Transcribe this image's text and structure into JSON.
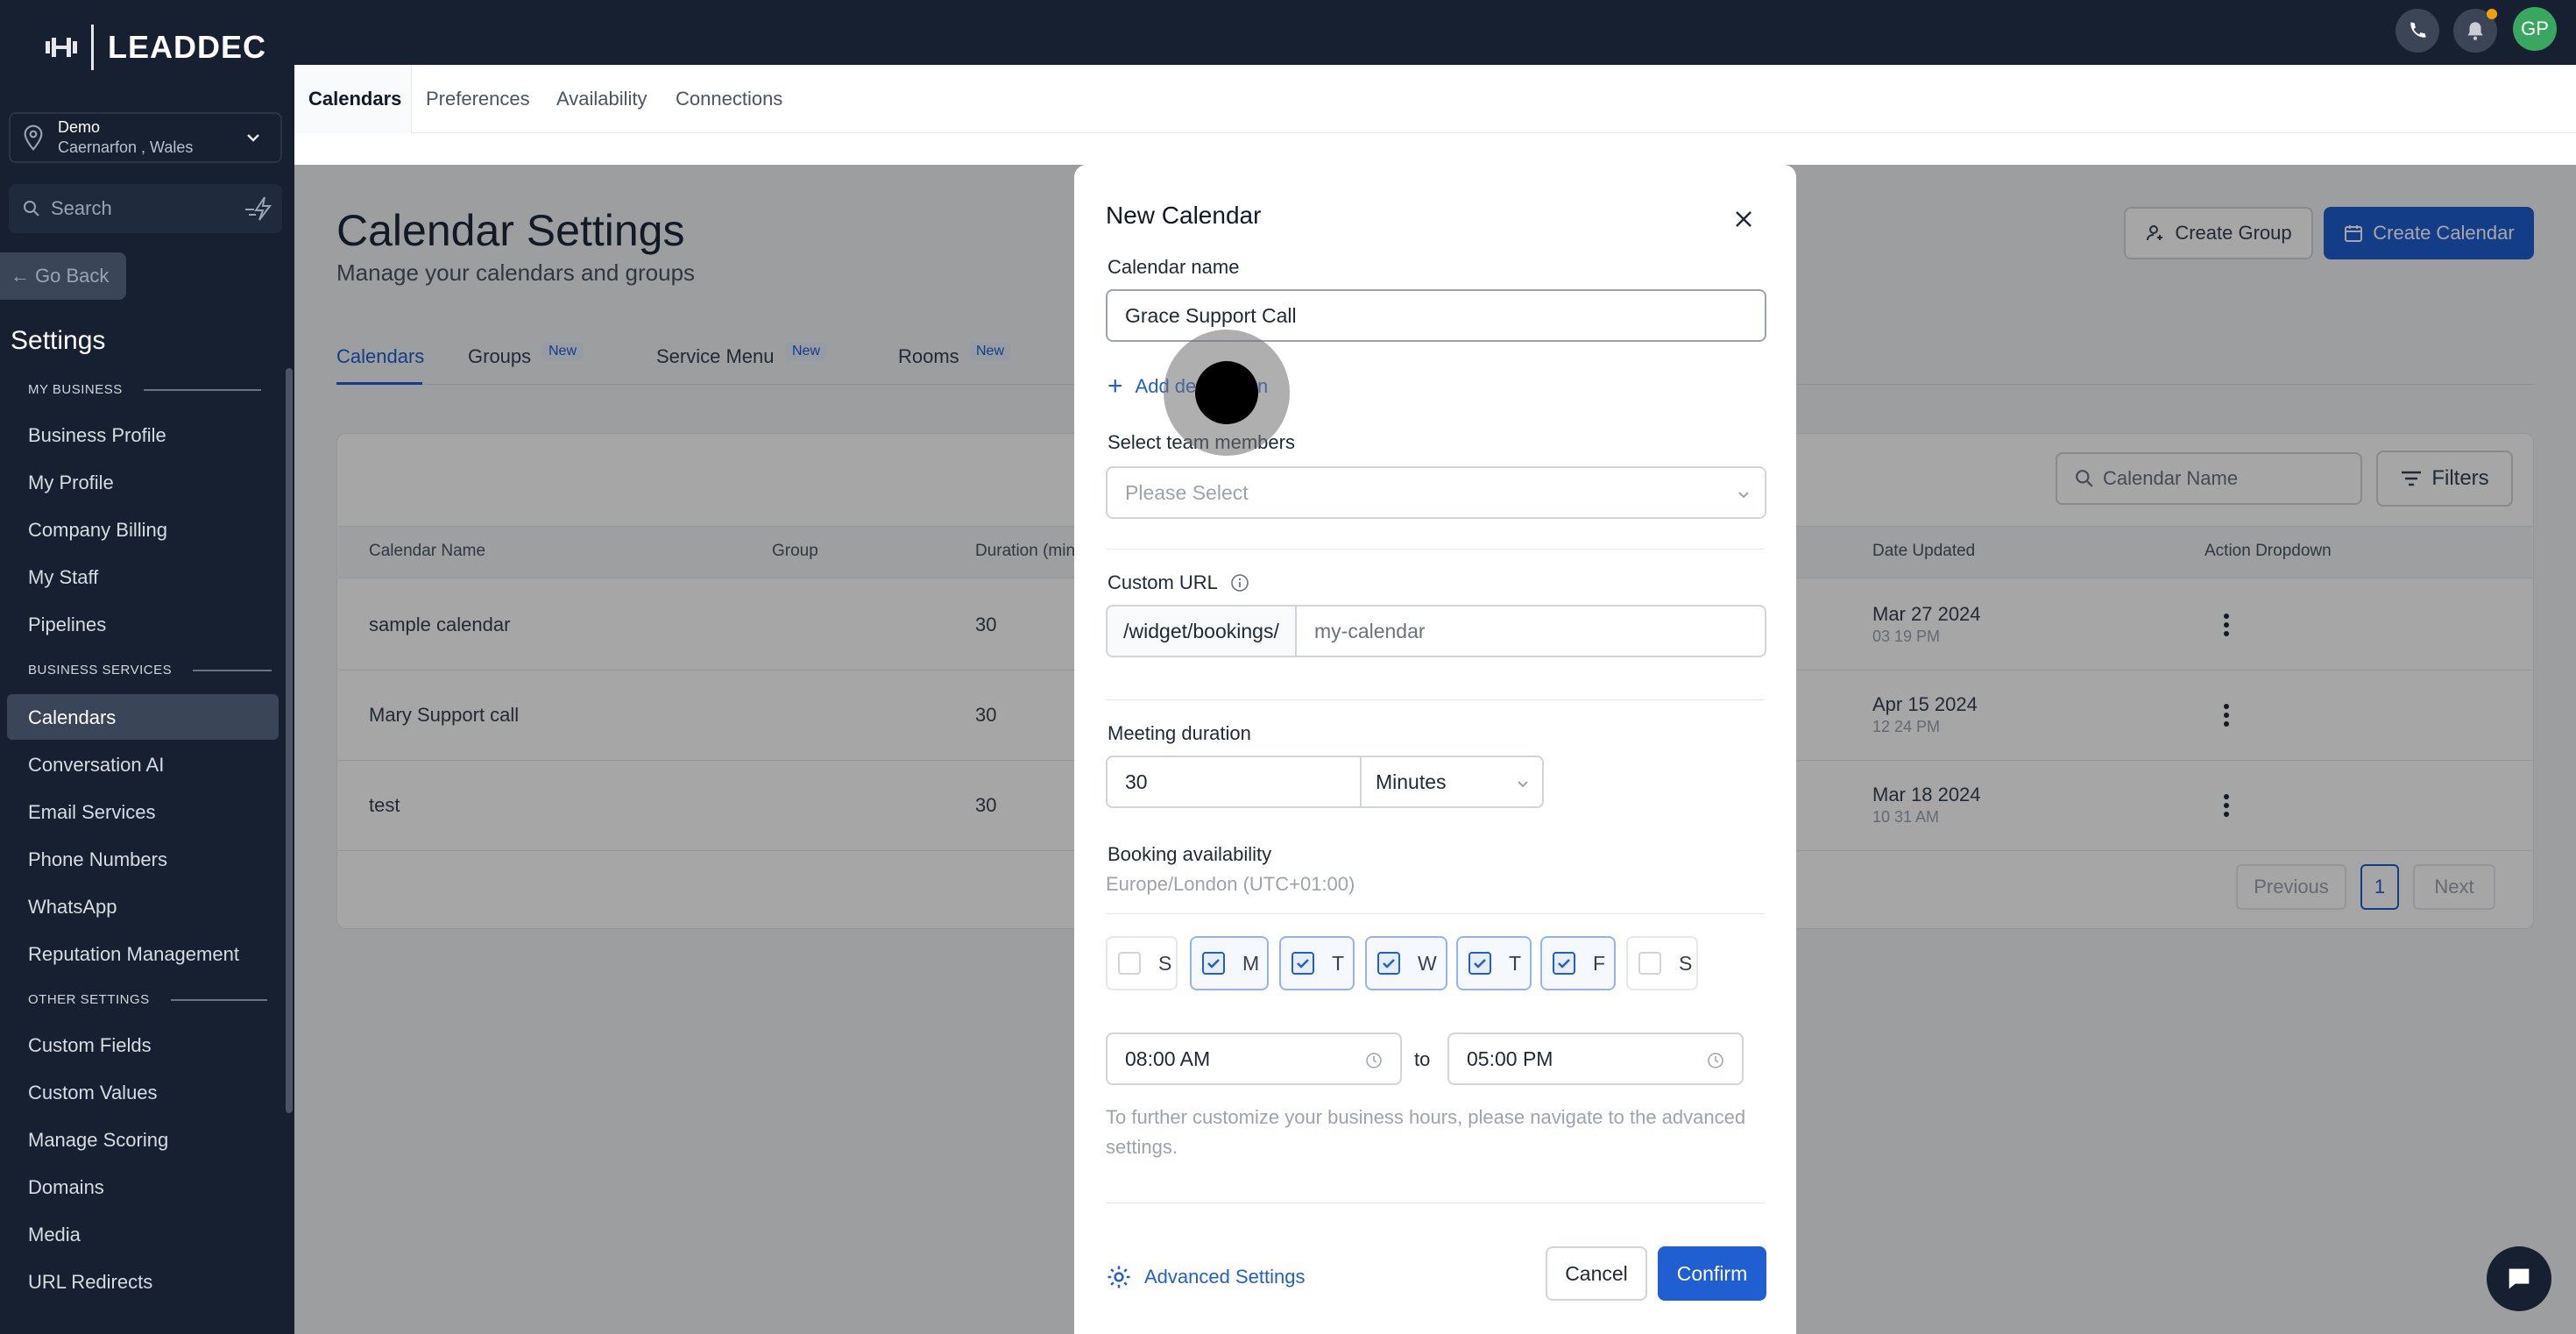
{
  "brand": {
    "name": "LEADDEC"
  },
  "location": {
    "name": "Demo",
    "address": "Caernarfon , Wales"
  },
  "sidebar": {
    "search_placeholder": "Search",
    "go_back": "Go Back",
    "title": "Settings",
    "sections": [
      {
        "label": "MY BUSINESS",
        "items": [
          "Business Profile",
          "My Profile",
          "Company Billing",
          "My Staff",
          "Pipelines"
        ]
      },
      {
        "label": "BUSINESS SERVICES",
        "items": [
          "Calendars",
          "Conversation AI",
          "Email Services",
          "Phone Numbers",
          "WhatsApp",
          "Reputation Management"
        ]
      },
      {
        "label": "OTHER SETTINGS",
        "items": [
          "Custom Fields",
          "Custom Values",
          "Manage Scoring",
          "Domains",
          "Media",
          "URL Redirects"
        ]
      }
    ],
    "active_item": "Calendars"
  },
  "topbar": {
    "avatar_initials": "GP"
  },
  "subnav": {
    "tabs": [
      "Calendars",
      "Preferences",
      "Availability",
      "Connections"
    ],
    "active": "Calendars"
  },
  "page": {
    "title": "Calendar Settings",
    "subtitle": "Manage your calendars and groups",
    "create_group": "Create Group",
    "create_calendar": "Create Calendar",
    "tabs": [
      {
        "label": "Calendars",
        "badge": ""
      },
      {
        "label": "Groups",
        "badge": "New"
      },
      {
        "label": "Service Menu",
        "badge": "New"
      },
      {
        "label": "Rooms",
        "badge": "New"
      }
    ],
    "search_placeholder": "Calendar Name",
    "filters": "Filters",
    "columns": [
      "Calendar Name",
      "Group",
      "Duration (min",
      "Date Updated",
      "Action Dropdown"
    ],
    "rows": [
      {
        "name": "sample calendar",
        "duration": "30",
        "date": "Mar 27 2024",
        "time": "03 19 PM"
      },
      {
        "name": "Mary Support call",
        "duration": "30",
        "date": "Apr 15 2024",
        "time": "12 24 PM"
      },
      {
        "name": "test",
        "duration": "30",
        "date": "Mar 18 2024",
        "time": "10 31 AM"
      }
    ],
    "pagination": {
      "previous": "Previous",
      "page": "1",
      "next": "Next"
    }
  },
  "modal": {
    "title": "New Calendar",
    "calendar_name_label": "Calendar name",
    "calendar_name_value": "Grace Support Call",
    "add_description": "Add description",
    "team_label": "Select team members",
    "team_placeholder": "Please Select",
    "custom_url_label": "Custom URL",
    "url_prefix": "/widget/bookings/",
    "url_placeholder": "my-calendar",
    "duration_label": "Meeting duration",
    "duration_value": "30",
    "duration_unit": "Minutes",
    "availability_label": "Booking availability",
    "timezone": "Europe/London (UTC+01:00)",
    "days": [
      {
        "label": "S",
        "checked": false
      },
      {
        "label": "M",
        "checked": true
      },
      {
        "label": "T",
        "checked": true
      },
      {
        "label": "W",
        "checked": true
      },
      {
        "label": "T",
        "checked": true
      },
      {
        "label": "F",
        "checked": true
      },
      {
        "label": "S",
        "checked": false
      }
    ],
    "start_time": "08:00 AM",
    "to": "to",
    "end_time": "05:00 PM",
    "note": "To further customize your business hours, please navigate to the advanced settings.",
    "advanced": "Advanced Settings",
    "cancel": "Cancel",
    "confirm": "Confirm"
  }
}
